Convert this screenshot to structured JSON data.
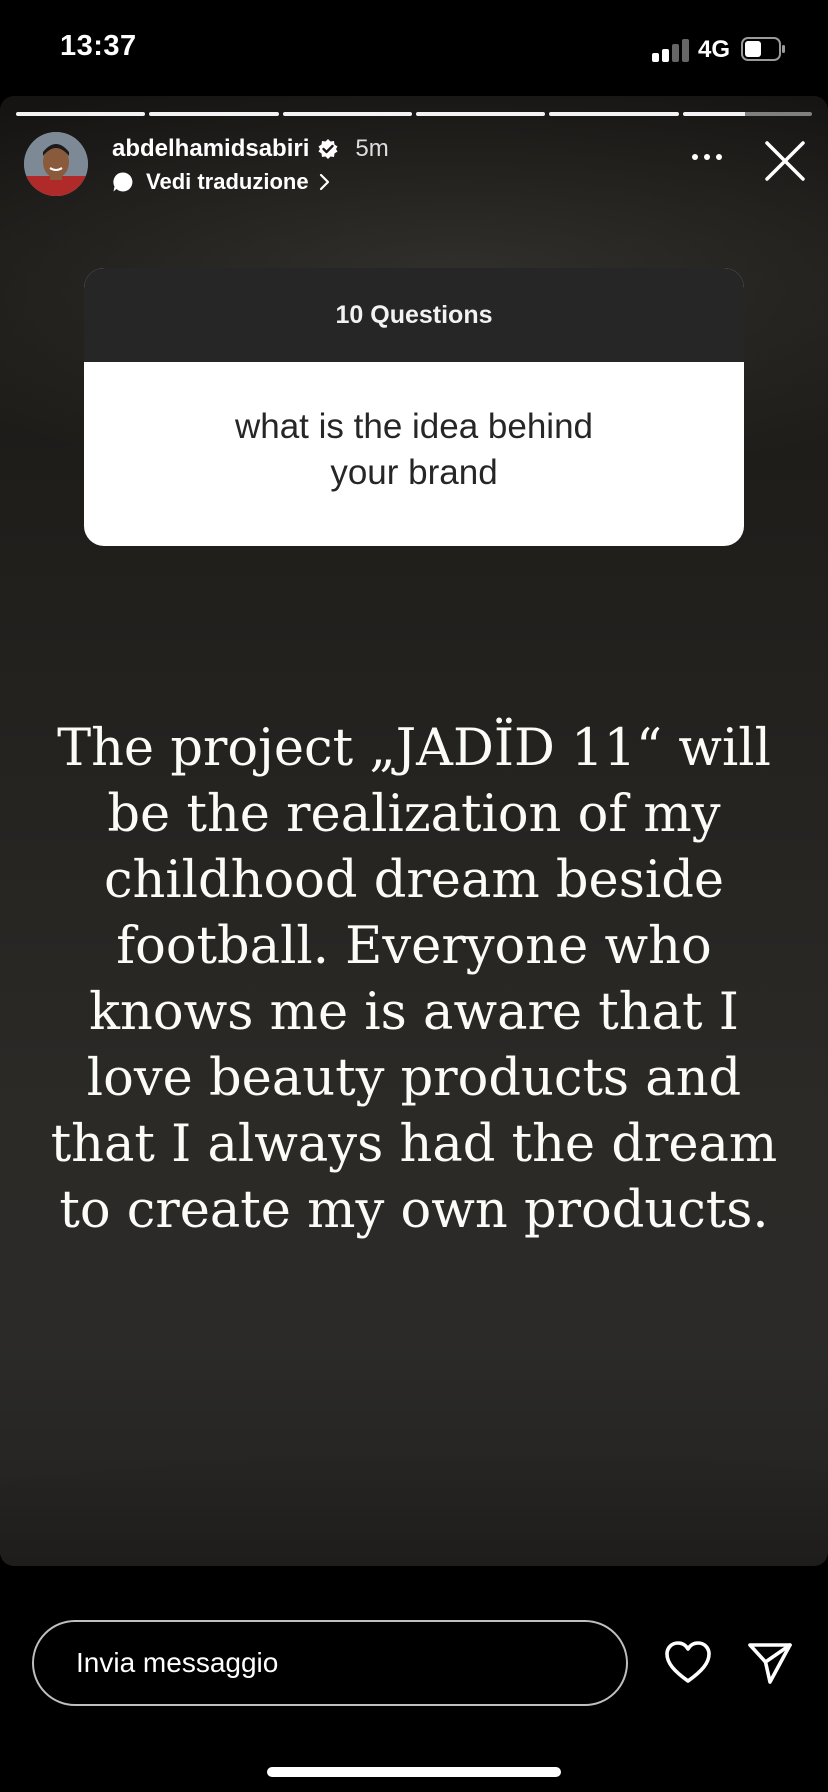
{
  "status_bar": {
    "time": "13:37",
    "network": "4G",
    "signal_bars_filled": 2,
    "signal_bars_total": 4
  },
  "story": {
    "progress": {
      "segments": 6,
      "completed": 5,
      "current_fraction": 0.5
    },
    "username": "abdelhamidsabiri",
    "verified_icon": "verified-badge-icon",
    "time_ago": "5m",
    "translate_label": "Vedi traduzione",
    "question_sticker": {
      "header": "10 Questions",
      "question": "what is the idea behind your brand"
    },
    "answer": "The project „JADÏD 11“ will be the realization of my childhood dream beside football. Everyone who knows me is aware that I love beauty products and that I always had the dream to create my own products."
  },
  "reply_bar": {
    "placeholder": "Invia messaggio"
  },
  "colors": {
    "background": "#000000",
    "question_header": "#262626",
    "question_body": "#ffffff"
  }
}
